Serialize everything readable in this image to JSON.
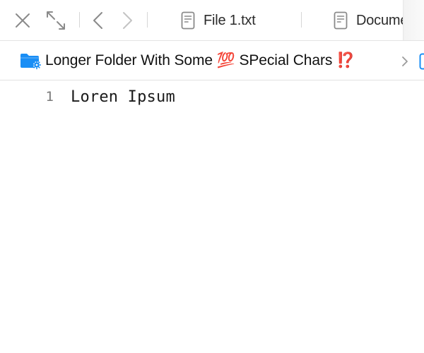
{
  "toolbar": {
    "buttons": [
      {
        "name": "close-button",
        "icon": "close-icon"
      },
      {
        "name": "expand-button",
        "icon": "expand-icon"
      },
      {
        "name": "back-button",
        "icon": "chevron-left-icon"
      },
      {
        "name": "forward-button",
        "icon": "chevron-right-icon"
      }
    ]
  },
  "tabs": [
    {
      "label": "File 1.txt",
      "icon": "document-icon"
    },
    {
      "label": "Document",
      "icon": "document-icon"
    }
  ],
  "breadcrumb": {
    "folder_icon": "folder-settings-icon",
    "label": "Longer Folder With Some 💯 SPecial Chars ⁉️",
    "separator_icon": "chevron-right-icon",
    "next_icon": "file-icon"
  },
  "editor": {
    "lines": [
      {
        "number": "1",
        "text": "Loren Ipsum"
      }
    ]
  },
  "colors": {
    "icon_gray": "#8a8a8a",
    "folder_blue": "#1a8ef5",
    "divider": "#e3e3e3"
  }
}
